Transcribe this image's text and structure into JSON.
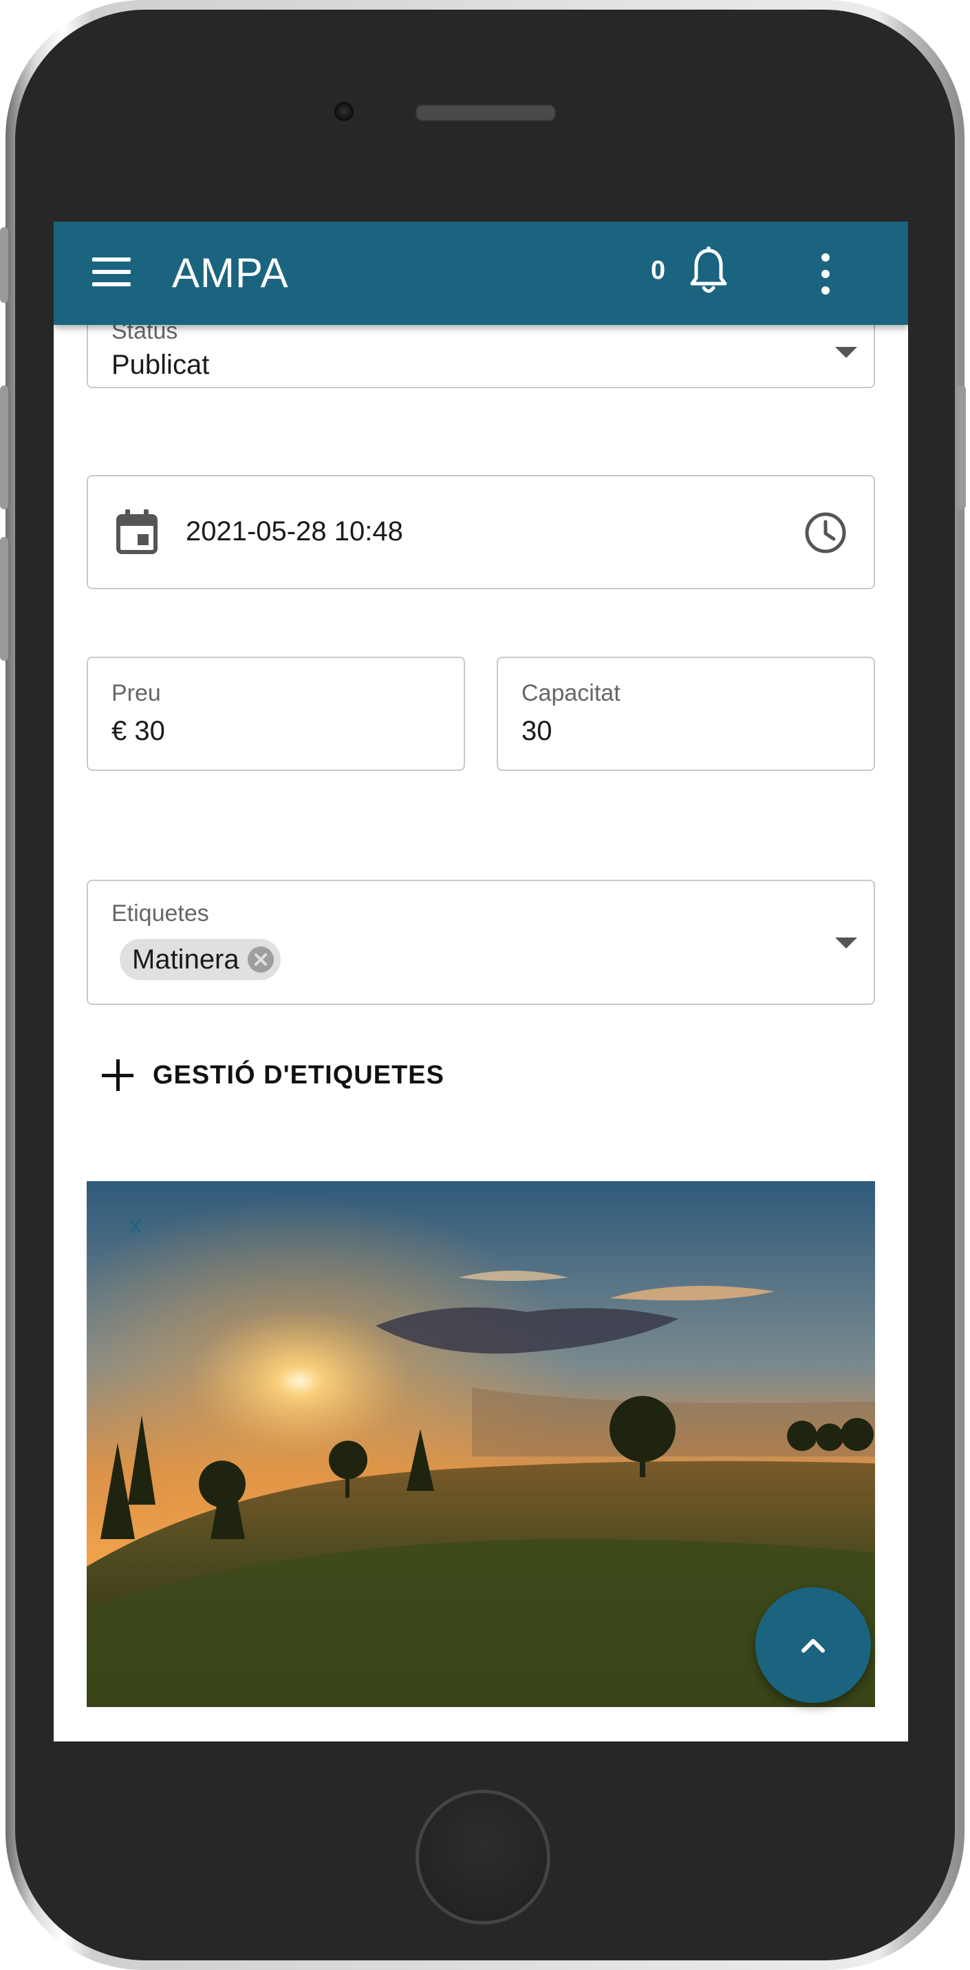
{
  "app": {
    "title": "AMPA",
    "notification_count": "0"
  },
  "form": {
    "status": {
      "label": "Status",
      "value": "Publicat"
    },
    "datetime": {
      "value": "2021-05-28 10:48"
    },
    "price": {
      "label": "Preu",
      "value": "€ 30"
    },
    "capacity": {
      "label": "Capacitat",
      "value": "30"
    },
    "tags": {
      "label": "Etiquetes",
      "chips": [
        "Matinera"
      ]
    },
    "tag_management_label": "GESTIÓ D'ETIQUETES",
    "image": {
      "remove_label": "x"
    }
  },
  "colors": {
    "primary": "#1b6480",
    "phone_body": "#272727"
  },
  "icons": [
    "menu-icon",
    "bell-icon",
    "more-vert-icon",
    "calendar-icon",
    "clock-icon",
    "chevron-down-icon",
    "close-circle-icon",
    "plus-icon",
    "chevron-up-icon"
  ]
}
